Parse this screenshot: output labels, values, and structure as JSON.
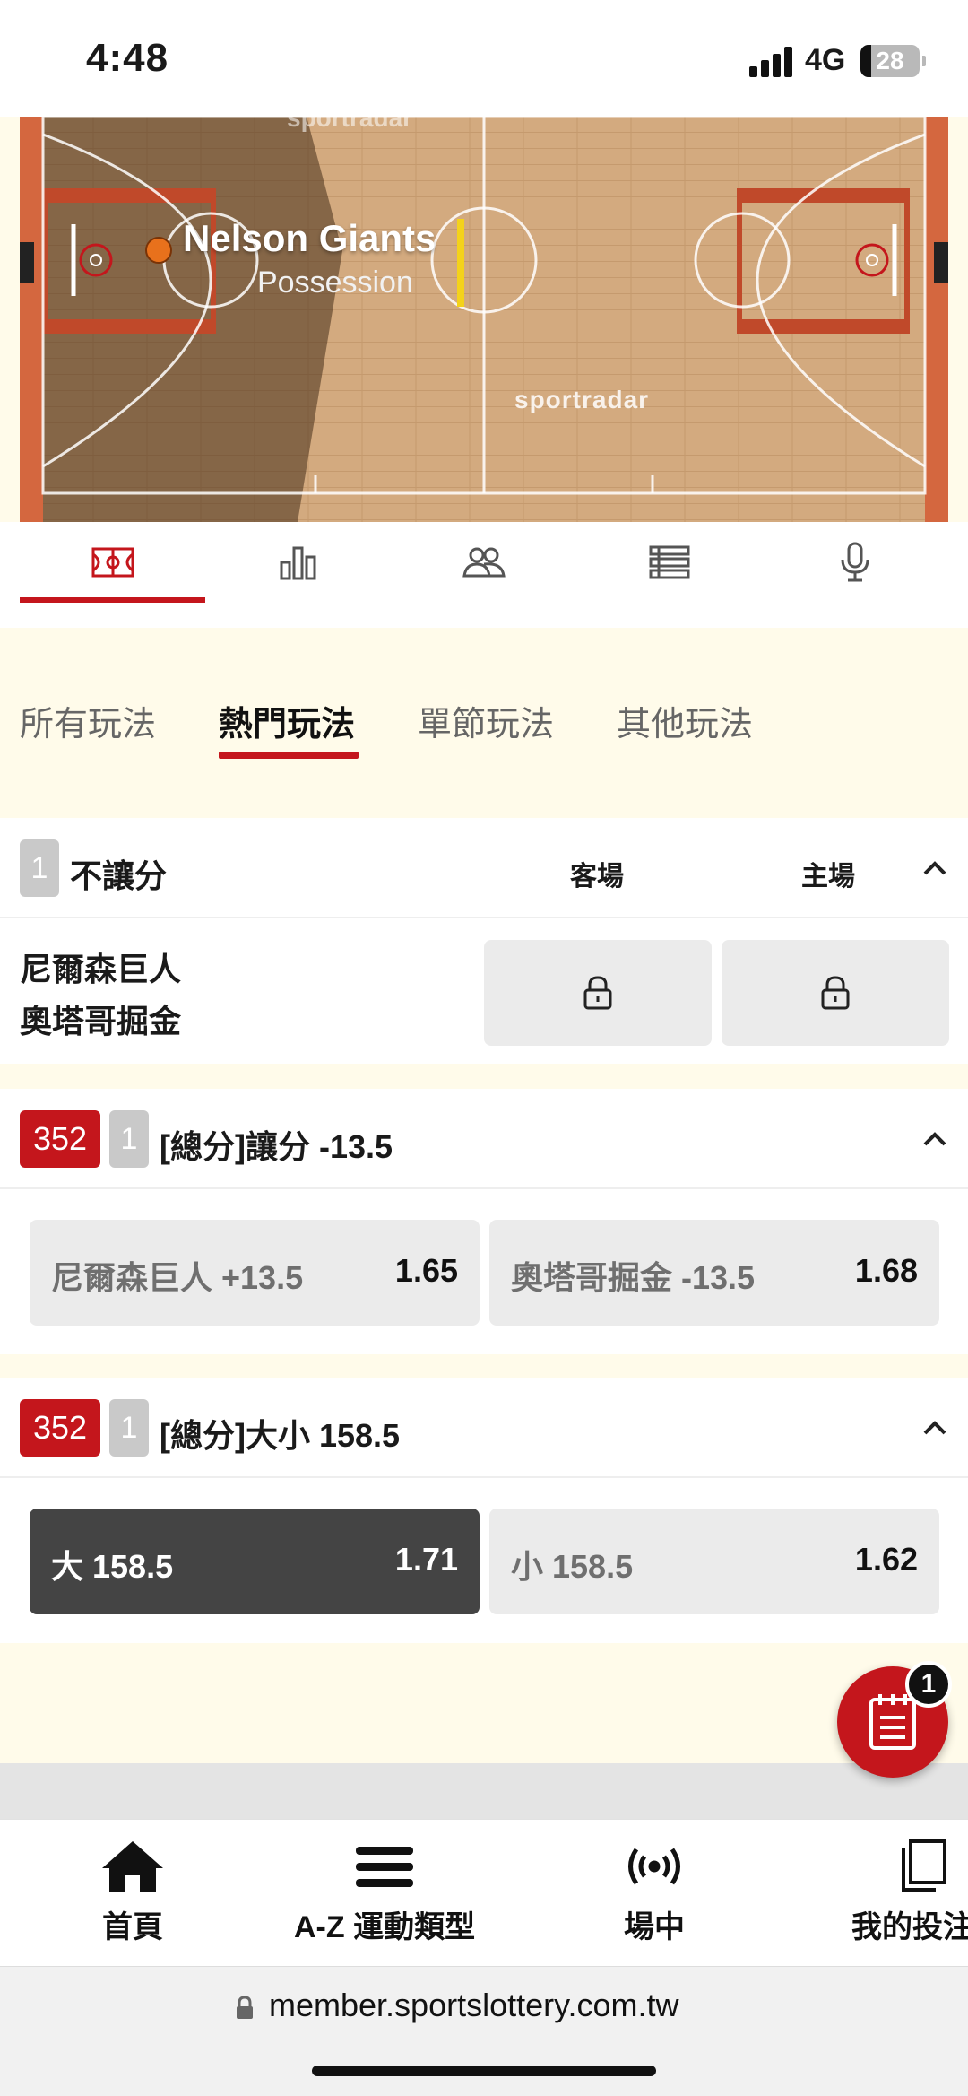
{
  "status_bar": {
    "time": "4:48",
    "network": "4G",
    "battery": "28"
  },
  "court": {
    "team": "Nelson Giants",
    "state": "Possession",
    "watermark": "sportradar"
  },
  "tool_tabs": [
    {
      "icon": "court-icon",
      "active": true
    },
    {
      "icon": "stats-icon",
      "active": false
    },
    {
      "icon": "players-icon",
      "active": false
    },
    {
      "icon": "list-icon",
      "active": false
    },
    {
      "icon": "microphone-icon",
      "active": false
    }
  ],
  "bet_tabs": [
    "所有玩法",
    "熱門玩法",
    "單節玩法",
    "其他玩法"
  ],
  "market1": {
    "num": "1",
    "title": "不讓分",
    "col_away": "客場",
    "col_home": "主場",
    "team1": "尼爾森巨人",
    "team2": "奧塔哥掘金"
  },
  "market2": {
    "code": "352",
    "num": "1",
    "title": "[總分]讓分 -13.5",
    "opt1_label": "尼爾森巨人 +13.5",
    "opt1_odds": "1.65",
    "opt2_label": "奧塔哥掘金 -13.5",
    "opt2_odds": "1.68"
  },
  "market3": {
    "code": "352",
    "num": "1",
    "title": "[總分]大小 158.5",
    "opt1_label": "大 158.5",
    "opt1_odds": "1.71",
    "opt2_label": "小 158.5",
    "opt2_odds": "1.62"
  },
  "bet_slip": {
    "count": "1"
  },
  "nav": [
    "首頁",
    "A-Z 運動類型",
    "場中",
    "我的投注"
  ],
  "url": "member.sportslottery.com.tw",
  "colors": {
    "accent": "#c4161c",
    "background": "#fffbea"
  }
}
